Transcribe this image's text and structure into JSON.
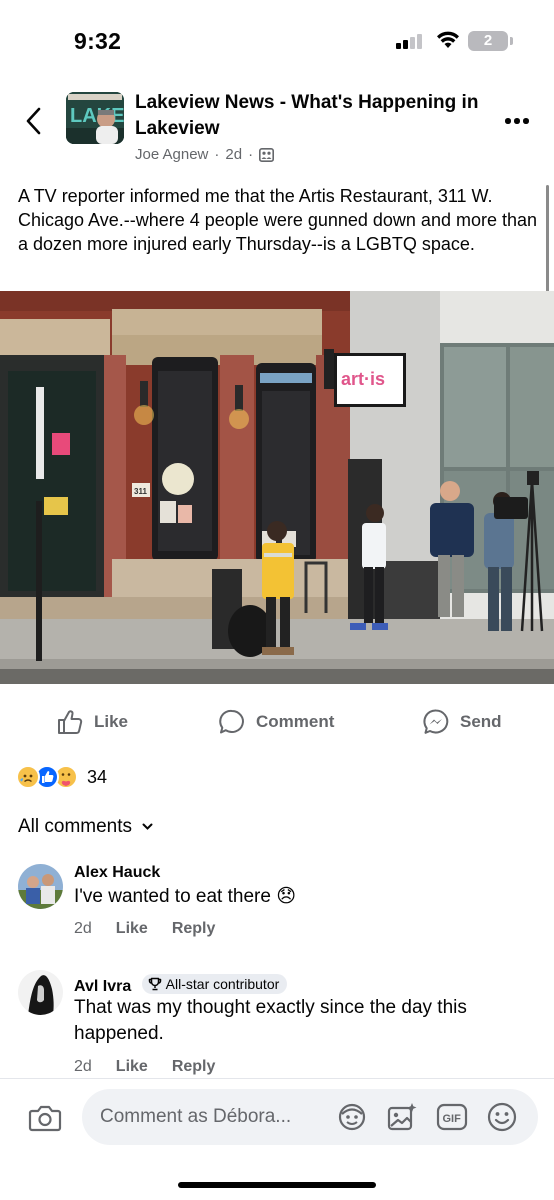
{
  "status_bar": {
    "time": "9:32",
    "battery_level": "2"
  },
  "post": {
    "page_name": "Lakeview News - What's Happening in Lakeview",
    "author": "Joe Agnew",
    "age": "2d",
    "body": "A TV reporter informed me that the Artis Restaurant, 311 W. Chicago Ave.--where 4 people were gunned down and more than a dozen more injured early Thursday--is a LGBTQ space.",
    "photo": {
      "storefront_sign": "art·is",
      "address_number": "311"
    }
  },
  "actions": {
    "like": "Like",
    "comment": "Comment",
    "send": "Send"
  },
  "reactions": {
    "count": "34"
  },
  "comments_filter": "All comments",
  "comments": [
    {
      "author": "Alex Hauck",
      "text": "I've wanted to eat there 😞",
      "age": "2d",
      "like": "Like",
      "reply": "Reply"
    },
    {
      "author": "Avl Ivra",
      "badge": "All-star contributor",
      "text": "That was my thought exactly since the day this happened.",
      "age": "2d",
      "like": "Like",
      "reply": "Reply"
    }
  ],
  "composer": {
    "placeholder": "Comment as Débora..."
  },
  "colors": {
    "accent": "#0866ff",
    "muted": "#65676b",
    "brick": "#8a3b2c"
  }
}
